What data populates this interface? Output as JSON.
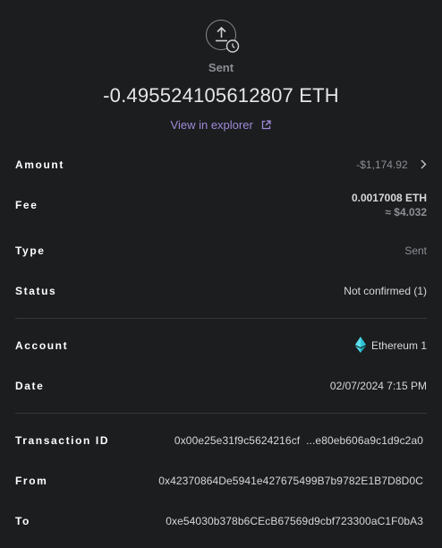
{
  "header": {
    "status_icon": "upload-clock-icon",
    "status_label": "Sent",
    "amount": "-0.495524105612807 ETH",
    "explorer_label": "View in explorer",
    "explorer_icon": "external-link-icon"
  },
  "details": {
    "amount": {
      "label": "Amount",
      "value": "-$1,174.92",
      "icon": "chevron-right-icon"
    },
    "fee": {
      "label": "Fee",
      "value_crypto": "0.0017008 ETH",
      "value_fiat": "≈ $4.032"
    },
    "type": {
      "label": "Type",
      "value": "Sent"
    },
    "status": {
      "label": "Status",
      "value": "Not confirmed (1)"
    },
    "account": {
      "label": "Account",
      "value": "Ethereum 1",
      "icon": "ethereum-icon"
    },
    "date": {
      "label": "Date",
      "value": "02/07/2024 7:15 PM"
    },
    "transaction_id": {
      "label": "Transaction ID",
      "value": "0x00e25e31f9c5624216cf  ...e80eb606a9c1d9c2a0"
    },
    "from": {
      "label": "From",
      "value": "0x42370864De5941e427675499B7b9782E1B7D8D0C"
    },
    "to": {
      "label": "To",
      "value": "0xe54030b378b6CEcB67569d9cbf723300aC1F0bA3"
    }
  },
  "colors": {
    "background": "#1c1d1f",
    "accent": "#9f8ad9",
    "muted": "#8d8e93",
    "divider": "#36373a"
  }
}
